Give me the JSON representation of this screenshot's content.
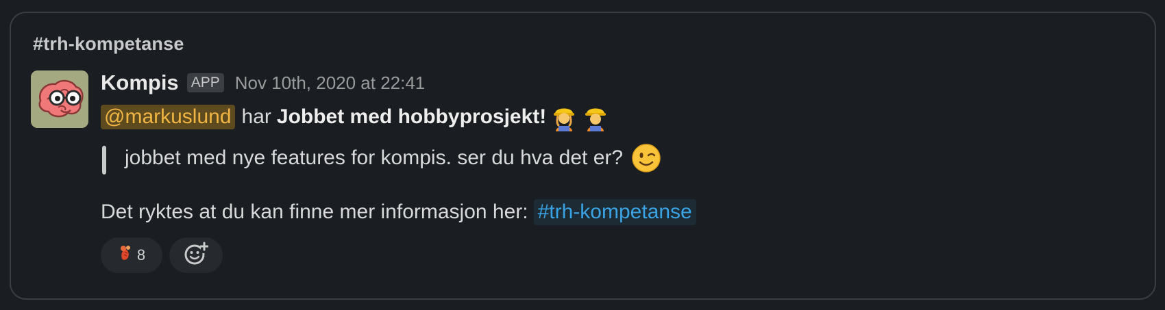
{
  "channel": {
    "name": "#trh-kompetanse"
  },
  "message": {
    "author": "Kompis",
    "badge": "APP",
    "timestamp": "Nov 10th, 2020 at 22:41",
    "mention": "@markuslund",
    "verb": "har",
    "achievement": "Jobbet med hobbyprosjekt!",
    "achievement_emojis": [
      "woman-construction-worker-icon",
      "man-construction-worker-icon"
    ],
    "quote": "jobbet med nye features for kompis. ser du hva det er?",
    "quote_emoji": "winking-face-icon",
    "info_text": "Det ryktes at du kan finne mer informasjon her:",
    "channel_link": "#trh-kompetanse"
  },
  "reactions": [
    {
      "icon": "lobster-icon",
      "count": "8"
    }
  ],
  "colors": {
    "background": "#1a1d21",
    "mention_bg": "#5e4a1f",
    "mention_text": "#f0b543",
    "link_text": "#3aa3e3",
    "avatar_bg": "#a4a982"
  }
}
